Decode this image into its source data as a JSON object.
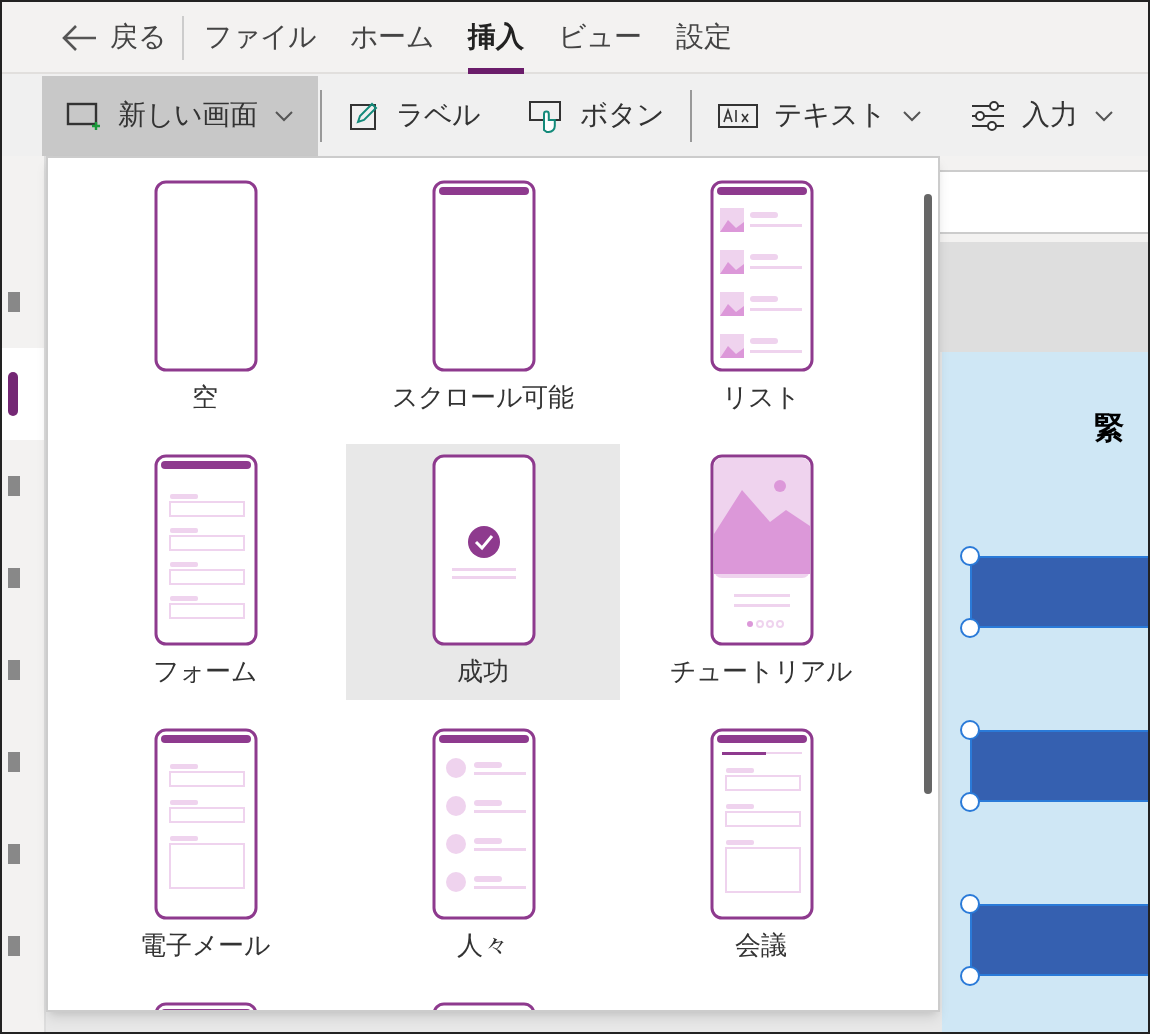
{
  "nav": {
    "back": "戻る",
    "tabs": [
      {
        "label": "ファイル",
        "selected": false
      },
      {
        "label": "ホーム",
        "selected": false
      },
      {
        "label": "挿入",
        "selected": true
      },
      {
        "label": "ビュー",
        "selected": false
      },
      {
        "label": "設定",
        "selected": false
      }
    ]
  },
  "ribbon": [
    {
      "kind": "screen",
      "label": "新しい画面",
      "dropdown": true,
      "expanded": true,
      "divider_after": true
    },
    {
      "kind": "pencil",
      "label": "ラベル",
      "dropdown": false,
      "expanded": false,
      "divider_after": false
    },
    {
      "kind": "button",
      "label": "ボタン",
      "dropdown": false,
      "expanded": false,
      "divider_after": true
    },
    {
      "kind": "text",
      "label": "テキスト",
      "dropdown": true,
      "expanded": false,
      "divider_after": false
    },
    {
      "kind": "sliders",
      "label": "入力",
      "dropdown": true,
      "expanded": false,
      "divider_after": false
    }
  ],
  "sidebar": {
    "items": [
      {
        "selected": false
      },
      {
        "selected": true
      },
      {
        "selected": false
      },
      {
        "selected": false
      },
      {
        "selected": false
      },
      {
        "selected": false
      },
      {
        "selected": false
      },
      {
        "selected": false
      }
    ]
  },
  "canvas": {
    "title": "緊"
  },
  "screen_templates": [
    {
      "kind": "blank",
      "label": "空",
      "selected": false
    },
    {
      "kind": "header",
      "label": "スクロール可能",
      "selected": false
    },
    {
      "kind": "list",
      "label": "リスト",
      "selected": false
    },
    {
      "kind": "form",
      "label": "フォーム",
      "selected": false
    },
    {
      "kind": "success",
      "label": "成功",
      "selected": true
    },
    {
      "kind": "tutorial",
      "label": "チュートリアル",
      "selected": false
    },
    {
      "kind": "email",
      "label": "電子メール",
      "selected": false
    },
    {
      "kind": "people",
      "label": "人々",
      "selected": false
    },
    {
      "kind": "meeting",
      "label": "会議",
      "selected": false
    },
    {
      "kind": "header",
      "selected": false
    },
    {
      "kind": "document",
      "selected": false
    }
  ]
}
